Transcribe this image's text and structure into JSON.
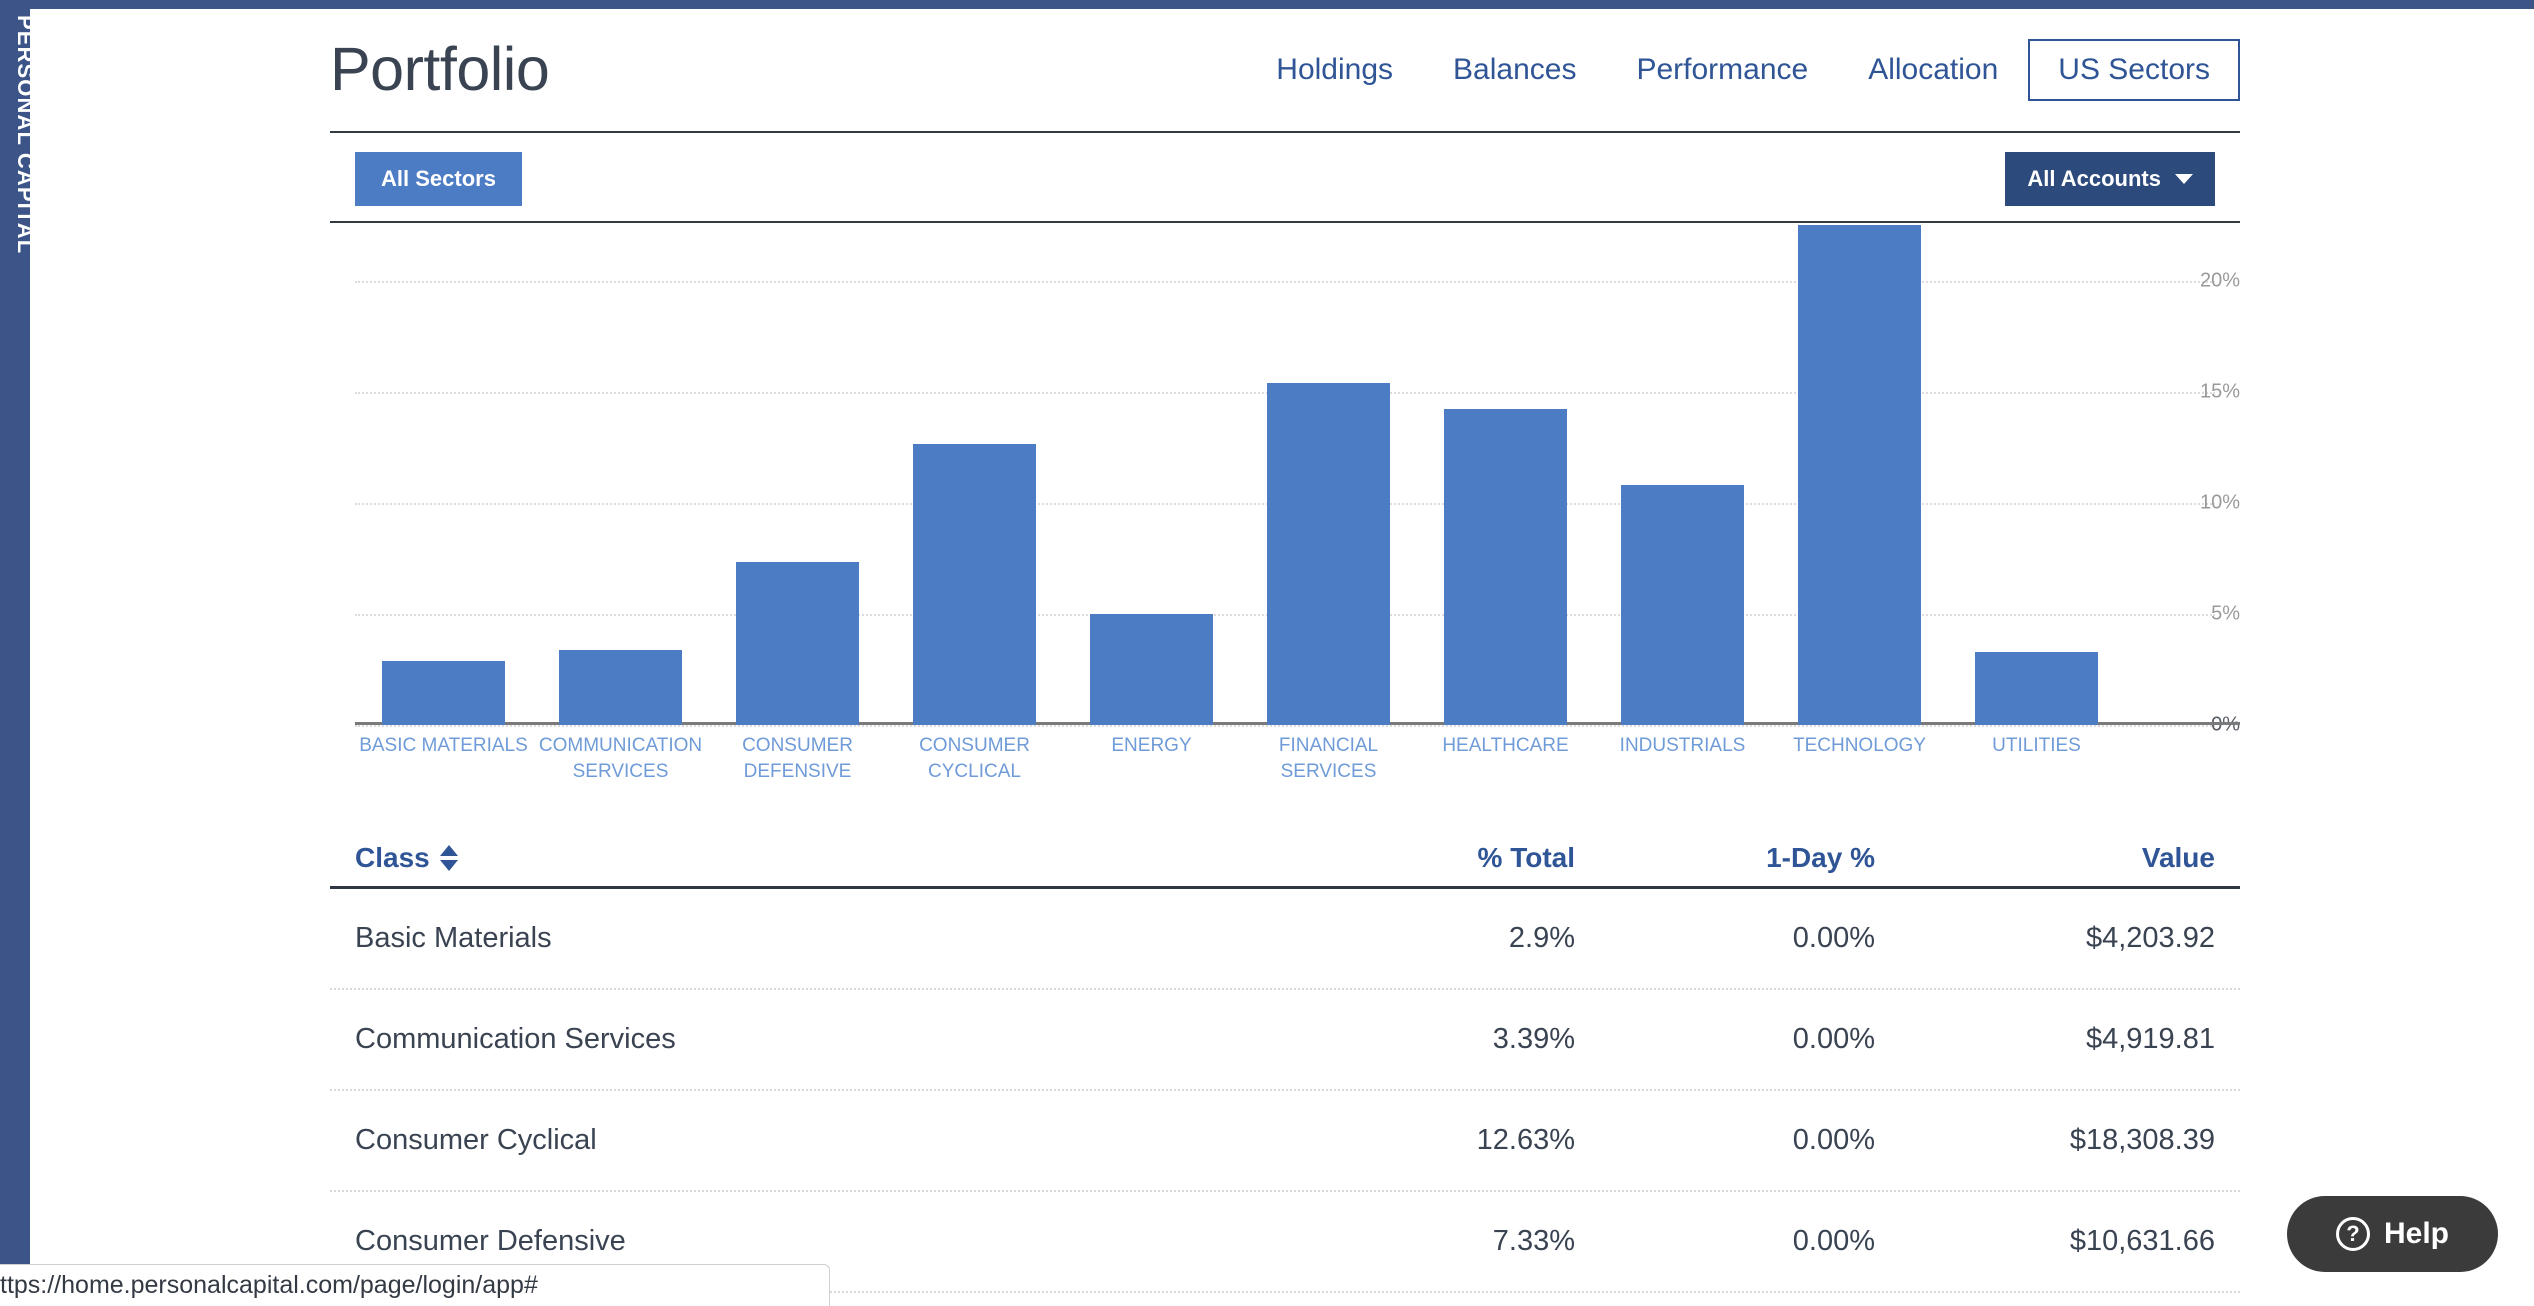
{
  "brand": {
    "rail_text": "PERSONAL CAPITAL",
    "rail_color": "#3c5488"
  },
  "header": {
    "title": "Portfolio",
    "tabs": [
      {
        "label": "Holdings",
        "active": false
      },
      {
        "label": "Balances",
        "active": false
      },
      {
        "label": "Performance",
        "active": false
      },
      {
        "label": "Allocation",
        "active": false
      },
      {
        "label": "US Sectors",
        "active": true
      }
    ]
  },
  "filter_bar": {
    "sectors_button": "All Sectors",
    "accounts_button": "All Accounts",
    "caret_icon": "chevron-down-icon",
    "sectors_color": "#4c7cc4",
    "accounts_color": "#2c4a7c"
  },
  "chart_data": {
    "type": "bar",
    "title": "",
    "xlabel": "",
    "ylabel": "",
    "ylim": [
      0,
      22.5
    ],
    "grid": true,
    "legend": "none",
    "bar_color": "#4c7cc4",
    "ytick_labels": [
      "0%",
      "5%",
      "10%",
      "15%",
      "20%"
    ],
    "ytick_values": [
      0,
      5,
      10,
      15,
      20
    ],
    "categories": [
      "BASIC MATERIALS",
      "COMMUNICATION SERVICES",
      "CONSUMER DEFENSIVE",
      "CONSUMER CYCLICAL",
      "ENERGY",
      "FINANCIAL SERVICES",
      "HEALTHCARE",
      "INDUSTRIALS",
      "TECHNOLOGY",
      "UTILITIES"
    ],
    "values": [
      2.9,
      3.39,
      7.33,
      12.63,
      5.0,
      15.4,
      14.2,
      10.8,
      24.4,
      3.3
    ]
  },
  "table": {
    "columns": {
      "class": "Class",
      "pct_total": "% Total",
      "one_day": "1-Day %",
      "value": "Value"
    },
    "sort_icon": "sort-arrows-icon",
    "rows": [
      {
        "class": "Basic Materials",
        "pct_total": "2.9%",
        "one_day": "0.00%",
        "value": "$4,203.92"
      },
      {
        "class": "Communication Services",
        "pct_total": "3.39%",
        "one_day": "0.00%",
        "value": "$4,919.81"
      },
      {
        "class": "Consumer Cyclical",
        "pct_total": "12.63%",
        "one_day": "0.00%",
        "value": "$18,308.39"
      },
      {
        "class": "Consumer Defensive",
        "pct_total": "7.33%",
        "one_day": "0.00%",
        "value": "$10,631.66"
      }
    ]
  },
  "help_widget": {
    "label": "Help",
    "icon": "question-circle-icon",
    "glyph": "?"
  },
  "status_bar": {
    "url": "ttps://home.personalcapital.com/page/login/app#"
  }
}
